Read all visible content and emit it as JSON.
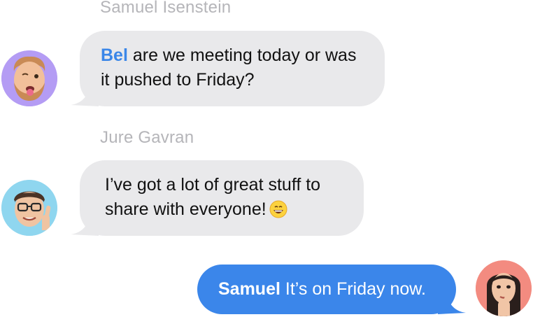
{
  "messages": [
    {
      "sender": "Samuel Isenstein",
      "mention": "Bel",
      "text": " are we meeting today or was it pushed to Friday?",
      "direction": "incoming",
      "avatar_icon": "memoji-winking-tongue-icon",
      "avatar_bg": "#b49cf4"
    },
    {
      "sender": "Jure Gavran",
      "text": "I’ve got a lot of great stuff to share with everyone!",
      "emoji_icon": "grinning-emoji-icon",
      "direction": "incoming",
      "avatar_icon": "memoji-glasses-thumbs-up-icon",
      "avatar_bg": "#8fd6ef"
    },
    {
      "mention": "Samuel",
      "text": " It’s on Friday now.",
      "direction": "outgoing",
      "avatar_icon": "memoji-thinking-woman-icon",
      "avatar_bg": "#f38b80"
    }
  ],
  "colors": {
    "incoming_bubble": "#e9e9eb",
    "outgoing_bubble": "#3b86ea",
    "mention_blue": "#3a86e8",
    "sender_name": "#b5b5b9"
  }
}
